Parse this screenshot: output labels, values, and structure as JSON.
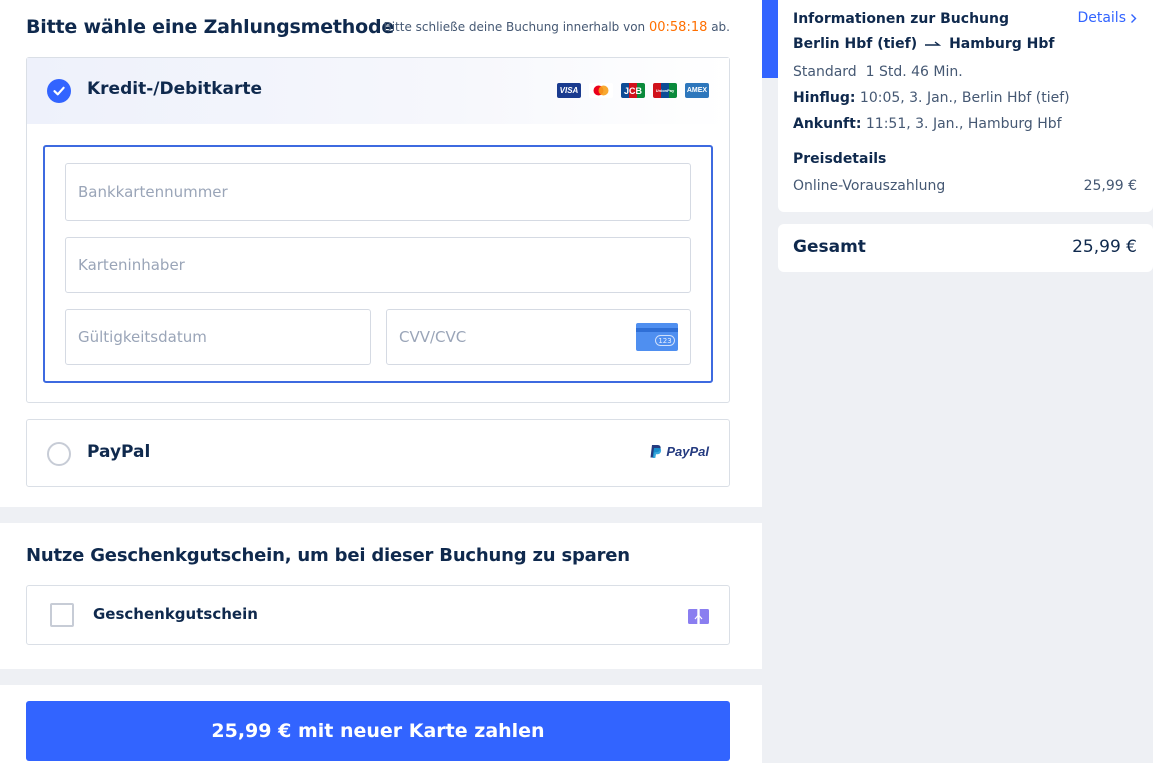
{
  "payment": {
    "title": "Bitte wähle eine Zahlungsmethode",
    "deadline_prefix": "Bitte schließe deine Buchung innerhalb von",
    "deadline_timer": "00:58:18",
    "deadline_suffix": "ab.",
    "card": {
      "label": "Kredit-/Debitkarte",
      "selected": true,
      "brands": [
        "VISA",
        "Mastercard",
        "JCB",
        "UnionPay",
        "AMEX"
      ],
      "brand_colors": {
        "visa": "#1a3b8f",
        "mastercard_red": "#eb001b",
        "mastercard_yellow": "#f79e1b",
        "jcb": "#0e4c96",
        "unionpay": "#d0121b",
        "amex": "#2e77bc"
      },
      "fields": {
        "card_number_placeholder": "Bankkartennummer",
        "card_holder_placeholder": "Karteninhaber",
        "expiry_placeholder": "Gültigkeitsdatum",
        "cvv_placeholder": "CVV/CVC",
        "cvv_icon_text": "123"
      }
    },
    "paypal": {
      "label": "PayPal",
      "logo_text": "PayPal",
      "selected": false
    }
  },
  "voucher": {
    "title": "Nutze Geschenkgutschein, um bei dieser Buchung zu sparen",
    "label": "Geschenkgutschein",
    "checked": false
  },
  "pay_button": {
    "label": "25,99 € mit neuer Karte zahlen"
  },
  "booking_info": {
    "title": "Informationen zur Buchung",
    "details_link": "Details",
    "route_from": "Berlin Hbf (tief)",
    "route_to": "Hamburg Hbf",
    "fare_class": "Standard",
    "duration": "1 Std. 46 Min.",
    "departure_label": "Hinflug:",
    "departure_value": "10:05, 3. Jan., Berlin Hbf (tief)",
    "arrival_label": "Ankunft:",
    "arrival_value": "11:51, 3. Jan., Hamburg Hbf",
    "price_details_title": "Preisdetails",
    "price_line_label": "Online-Vorauszahlung",
    "price_line_value": "25,99 €"
  },
  "total": {
    "label": "Gesamt",
    "value": "25,99 €"
  },
  "colors": {
    "accent": "#3264ff",
    "timer": "#ff6f00",
    "text_dark": "#0f294d",
    "text_muted": "#455873",
    "paypal_dark": "#253b80",
    "paypal_light": "#179bd7"
  }
}
